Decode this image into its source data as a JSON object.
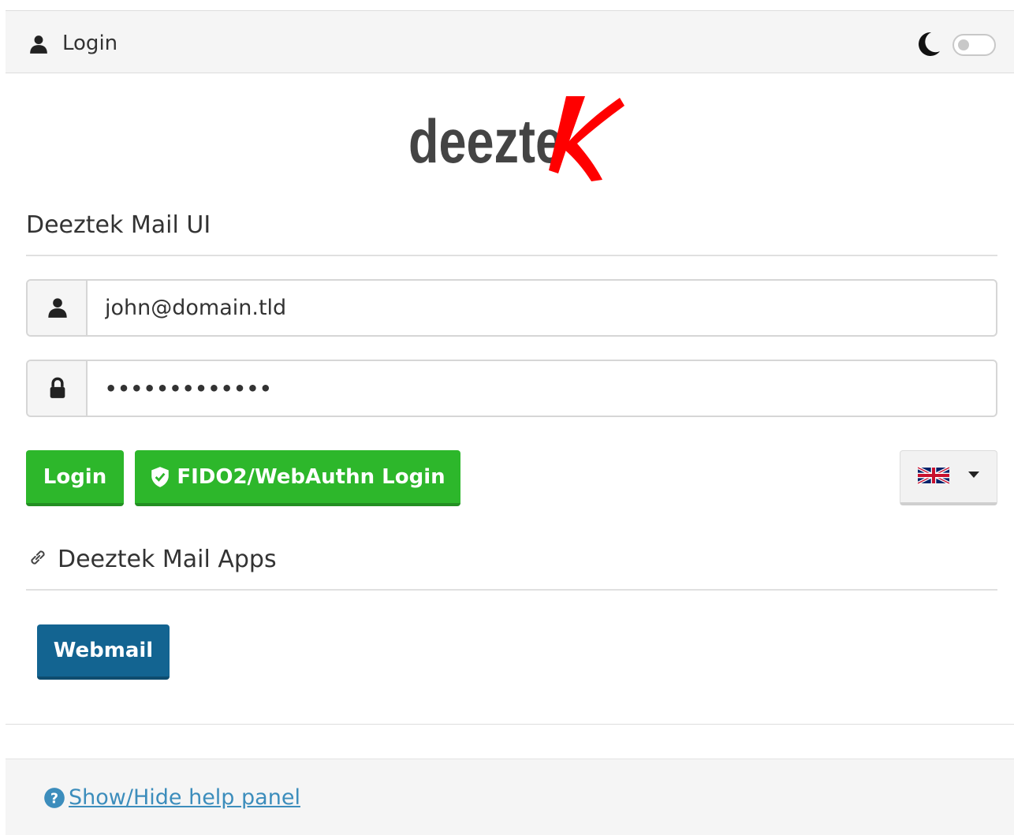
{
  "header": {
    "title": "Login",
    "user_icon": "user-icon",
    "theme_icon": "moon-icon",
    "dark_mode_toggle": "off"
  },
  "logo": {
    "text_main": "deezte",
    "text_accent": "K",
    "accent_color": "#ff0000",
    "text_color": "#444444"
  },
  "login_section": {
    "title": "Deeztek Mail UI",
    "username": {
      "value": "john@domain.tld",
      "icon": "user-icon"
    },
    "password": {
      "value": "•••••••••••••",
      "icon": "lock-icon"
    },
    "login_button": "Login",
    "fido_button": "FIDO2/WebAuthn Login",
    "fido_icon": "shield-check-icon",
    "language": {
      "selected": "English (UK)",
      "icon": "uk-flag-icon"
    }
  },
  "apps_section": {
    "title": "Deeztek Mail Apps",
    "icon": "link-icon",
    "webmail_button": "Webmail"
  },
  "footer": {
    "help_link": "Show/Hide help panel",
    "help_icon": "question-circle-icon"
  },
  "colors": {
    "green": "#2db72b",
    "blue": "#136491",
    "link": "#3c8dbc"
  }
}
